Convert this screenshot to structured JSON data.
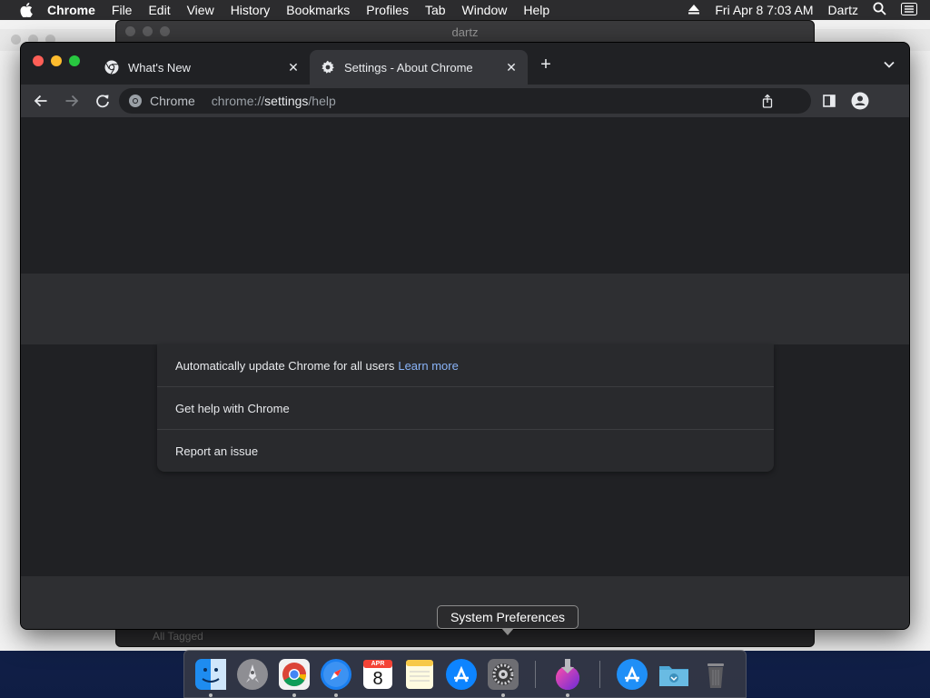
{
  "menubar": {
    "app_name": "Chrome",
    "items": [
      "File",
      "Edit",
      "View",
      "History",
      "Bookmarks",
      "Profiles",
      "Tab",
      "Window",
      "Help"
    ],
    "datetime": "Fri Apr 8  7:03 AM",
    "user": "Dartz"
  },
  "background_window": {
    "title": "dartz",
    "footer_text": "All Tagged"
  },
  "tabs": [
    {
      "title": "What's New",
      "icon": "chrome-logo-icon",
      "active": false
    },
    {
      "title": "Settings - About Chrome",
      "icon": "gear-icon",
      "active": true
    }
  ],
  "omnibox": {
    "site_name": "Chrome",
    "url_scheme": "chrome://",
    "url_host": "settings",
    "url_path": "/help"
  },
  "about_card": {
    "rows": [
      {
        "text": "Automatically update Chrome for all users",
        "link": "Learn more"
      },
      {
        "text": "Get help with Chrome"
      },
      {
        "text": "Report an issue"
      }
    ]
  },
  "dock": {
    "apps": [
      "Finder",
      "Launchpad",
      "Google Chrome",
      "Safari",
      "Calendar",
      "Notes",
      "App Store",
      "System Preferences",
      "Downloader",
      "App Store",
      "Downloads Folder",
      "Trash"
    ],
    "tooltip": "System Preferences",
    "calendar_month": "APR",
    "calendar_day": "8"
  },
  "colors": {
    "link": "#8ab4f8",
    "chrome_bg": "#202124",
    "toolbar_bg": "#35363a"
  }
}
